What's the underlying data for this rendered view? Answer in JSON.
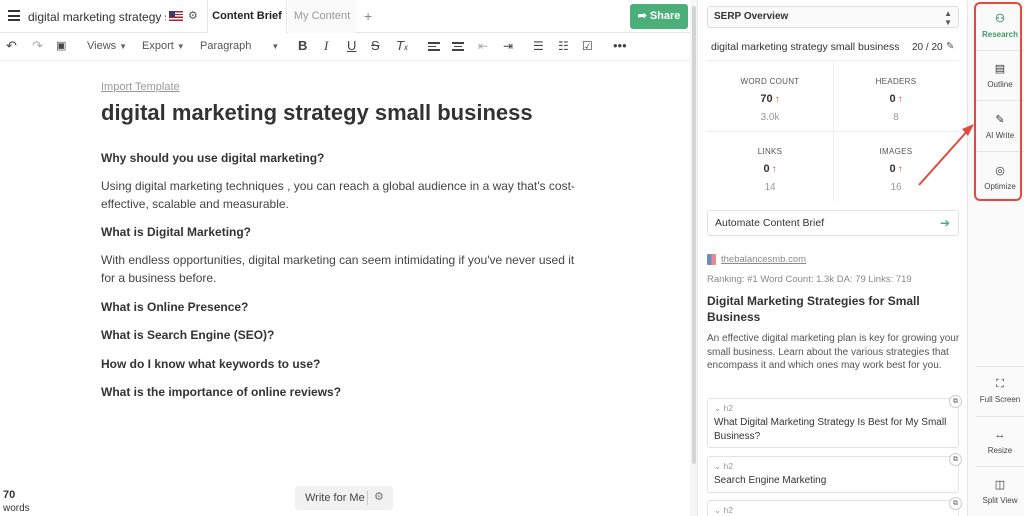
{
  "header": {
    "doc_title": "digital marketing strategy sma...",
    "tabs": [
      {
        "label": "Content Brief",
        "active": true
      },
      {
        "label": "My Content",
        "active": false
      }
    ],
    "add_tab_symbol": "+",
    "share_label": "Share"
  },
  "toolbar": {
    "views_label": "Views",
    "export_label": "Export",
    "paragraph_label": "Paragraph",
    "icons": [
      "undo-icon",
      "redo-icon",
      "save-icon",
      "bold-icon",
      "italic-icon",
      "underline-icon",
      "strikethrough-icon",
      "clear-format-icon",
      "align-left-icon",
      "align-center-icon",
      "outdent-icon",
      "indent-icon",
      "bullet-list-icon",
      "numbered-list-icon",
      "checklist-icon",
      "more-icon"
    ]
  },
  "editor": {
    "import_template": "Import Template",
    "title": "digital marketing strategy small business",
    "blocks": [
      {
        "type": "h3",
        "text": "Why should you use digital marketing?"
      },
      {
        "type": "p",
        "text": "Using digital marketing techniques , you can reach a global audience in a way that's cost-effective, scalable and measurable."
      },
      {
        "type": "h3",
        "text": "What is Digital Marketing?"
      },
      {
        "type": "p",
        "text": "With endless opportunities, digital marketing can seem intimidating if you've never used it for a business before."
      },
      {
        "type": "h3",
        "text": "What is Online Presence?"
      },
      {
        "type": "h3",
        "text": "What is Search Engine (SEO)?"
      },
      {
        "type": "h3",
        "text": "How do I know what keywords to use?"
      },
      {
        "type": "h3",
        "text": "What is the importance of online reviews?"
      }
    ],
    "word_count": "70",
    "word_count_label": "words",
    "write_for_me": "Write for Me"
  },
  "serp": {
    "dropdown_label": "SERP Overview",
    "keyword": "digital marketing strategy small business",
    "keyword_count": "20 / 20",
    "stats": [
      {
        "label": "WORD COUNT",
        "value": "70",
        "target": "3.0k"
      },
      {
        "label": "HEADERS",
        "value": "0",
        "target": "8"
      },
      {
        "label": "LINKS",
        "value": "0",
        "target": "14"
      },
      {
        "label": "IMAGES",
        "value": "0",
        "target": "16"
      }
    ],
    "automate_label": "Automate Content Brief",
    "result": {
      "domain": "thebalancesmb.com",
      "meta": "Ranking: #1   Word Count: 1.3k   DA: 79   Links: 719",
      "title": "Digital Marketing Strategies for Small Business",
      "description": "An effective digital marketing plan is key for growing your small business. Learn about the various strategies that encompass it and which ones may work best for you.",
      "headings": [
        {
          "tag": "h2",
          "text": "What Digital Marketing Strategy Is Best for My Small Business?"
        },
        {
          "tag": "h2",
          "text": "Search Engine Marketing"
        },
        {
          "tag": "h2",
          "text": ""
        }
      ]
    }
  },
  "rail": {
    "top": [
      {
        "label": "Research",
        "icon": "research-icon",
        "active": true
      },
      {
        "label": "Outline",
        "icon": "document-icon",
        "active": false
      },
      {
        "label": "AI Write",
        "icon": "pen-icon",
        "active": false
      },
      {
        "label": "Optimize",
        "icon": "target-icon",
        "active": false
      }
    ],
    "bottom": [
      {
        "label": "Full Screen",
        "icon": "fullscreen-icon"
      },
      {
        "label": "Resize",
        "icon": "resize-icon"
      },
      {
        "label": "Split View",
        "icon": "split-view-icon"
      }
    ]
  },
  "colors": {
    "accent_green": "#4cae78",
    "highlight_red": "#e14a3d",
    "up_arrow_red": "#e0483e"
  }
}
